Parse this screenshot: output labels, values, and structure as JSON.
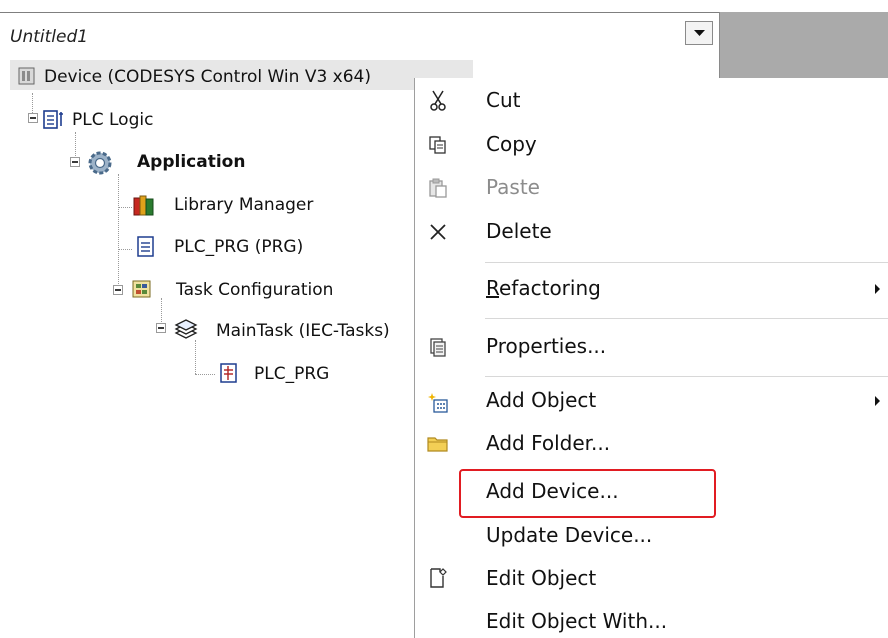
{
  "panel": {
    "title": "Untitled1",
    "dropdown_icon": "chevron-down-icon"
  },
  "tree": [
    {
      "label": "Device (CODESYS Control Win V3 x64)",
      "icon": "device-icon",
      "bold": false
    },
    {
      "label": "PLC Logic",
      "icon": "plc-logic-icon",
      "bold": false
    },
    {
      "label": "Application",
      "icon": "gear-icon",
      "bold": true
    },
    {
      "label": "Library Manager",
      "icon": "books-icon",
      "bold": false
    },
    {
      "label": "PLC_PRG (PRG)",
      "icon": "document-icon",
      "bold": false
    },
    {
      "label": "Task Configuration",
      "icon": "task-config-icon",
      "bold": false
    },
    {
      "label": "MainTask (IEC-Tasks)",
      "icon": "task-stack-icon",
      "bold": false
    },
    {
      "label": "PLC_PRG",
      "icon": "program-call-icon",
      "bold": false
    }
  ],
  "context_menu": {
    "items": [
      {
        "label": "Cut",
        "icon": "scissors-icon",
        "enabled": true
      },
      {
        "label": "Copy",
        "icon": "copy-icon",
        "enabled": true
      },
      {
        "label": "Paste",
        "icon": "paste-icon",
        "enabled": false
      },
      {
        "label": "Delete",
        "icon": "delete-x-icon",
        "enabled": true
      },
      {
        "label_underline": "R",
        "label_rest": "efactoring",
        "icon": "",
        "enabled": true,
        "submenu": true
      },
      {
        "label": "Properties...",
        "icon": "properties-icon",
        "enabled": true
      },
      {
        "label": "Add Object",
        "icon": "add-object-icon",
        "enabled": true,
        "submenu": true
      },
      {
        "label": "Add Folder...",
        "icon": "folder-icon",
        "enabled": true
      },
      {
        "label": "Add Device...",
        "icon": "",
        "enabled": true,
        "highlighted": true
      },
      {
        "label": "Update Device...",
        "icon": "",
        "enabled": true
      },
      {
        "label": "Edit Object",
        "icon": "edit-object-icon",
        "enabled": true
      },
      {
        "label": "Edit Object With...",
        "icon": "",
        "enabled": true
      }
    ]
  },
  "colors": {
    "highlight_border": "#e11c22",
    "background_gray": "#aaaaaa"
  }
}
